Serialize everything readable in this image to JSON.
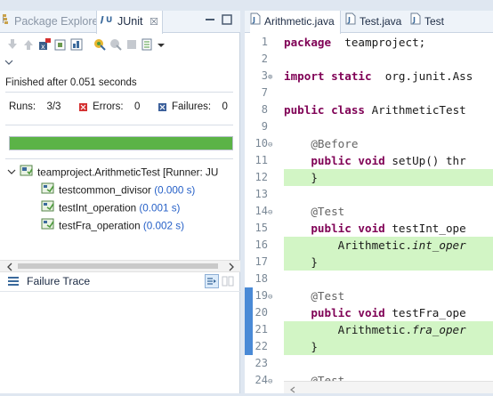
{
  "left_view": {
    "tabs": {
      "package_explorer": "Package Explorer",
      "junit": "JUnit",
      "junit_close": "☒"
    },
    "status": "Finished after 0.051 seconds",
    "counters": {
      "runs_label": "Runs:",
      "runs_value": "3/3",
      "errors_label": "Errors:",
      "errors_value": "0",
      "failures_label": "Failures:",
      "failures_value": "0"
    },
    "progress": 1.0,
    "progress_color": "#5bb347",
    "tree": {
      "root": "teamproject.ArithmeticTest [Runner: JU",
      "tests": [
        {
          "name": "testcommon_divisor",
          "time": "(0.000 s)"
        },
        {
          "name": "testInt_operation",
          "time": "(0.001 s)"
        },
        {
          "name": "testFra_operation",
          "time": "(0.002 s)"
        }
      ]
    },
    "failure_trace": "Failure Trace"
  },
  "editor": {
    "tabs": [
      "Arithmetic.java",
      "Test.java",
      "Test"
    ],
    "lines": [
      {
        "n": "1",
        "fold": "",
        "hl": false,
        "parts": [
          [
            "kw",
            "package"
          ],
          [
            "",
            "  teamproject;"
          ]
        ]
      },
      {
        "n": "2",
        "fold": "",
        "hl": false,
        "parts": []
      },
      {
        "n": "3",
        "fold": "⊕",
        "hl": false,
        "parts": [
          [
            "kw",
            "import static"
          ],
          [
            "",
            "  org.junit.Ass"
          ]
        ]
      },
      {
        "n": "7",
        "fold": "",
        "hl": false,
        "parts": []
      },
      {
        "n": "8",
        "fold": "",
        "hl": false,
        "parts": [
          [
            "kw",
            "public class"
          ],
          [
            "",
            " ArithmeticTest"
          ]
        ]
      },
      {
        "n": "9",
        "fold": "",
        "hl": false,
        "parts": []
      },
      {
        "n": "10",
        "fold": "⊖",
        "hl": false,
        "parts": [
          [
            "an",
            "    @Before"
          ]
        ]
      },
      {
        "n": "11",
        "fold": "",
        "hl": false,
        "parts": [
          [
            "kw",
            "    public void"
          ],
          [
            "",
            " setUp() thr"
          ]
        ]
      },
      {
        "n": "12",
        "fold": "",
        "hl": true,
        "parts": [
          [
            "",
            "    }"
          ]
        ]
      },
      {
        "n": "13",
        "fold": "",
        "hl": false,
        "parts": []
      },
      {
        "n": "14",
        "fold": "⊖",
        "hl": false,
        "parts": [
          [
            "an",
            "    @Test"
          ]
        ]
      },
      {
        "n": "15",
        "fold": "",
        "hl": false,
        "parts": [
          [
            "kw",
            "    public void"
          ],
          [
            "",
            " testInt_ope"
          ]
        ]
      },
      {
        "n": "16",
        "fold": "",
        "hl": true,
        "parts": [
          [
            "",
            "        Arithmetic."
          ],
          [
            "it",
            "int_oper"
          ]
        ]
      },
      {
        "n": "17",
        "fold": "",
        "hl": true,
        "parts": [
          [
            "",
            "    }"
          ]
        ]
      },
      {
        "n": "18",
        "fold": "",
        "hl": false,
        "parts": []
      },
      {
        "n": "19",
        "fold": "⊖",
        "hl": false,
        "parts": [
          [
            "an",
            "    @Test"
          ]
        ]
      },
      {
        "n": "20",
        "fold": "",
        "hl": false,
        "parts": [
          [
            "kw",
            "    public void"
          ],
          [
            "",
            " testFra_ope"
          ]
        ]
      },
      {
        "n": "21",
        "fold": "",
        "hl": true,
        "parts": [
          [
            "",
            "        Arithmetic."
          ],
          [
            "it",
            "fra_oper"
          ]
        ]
      },
      {
        "n": "22",
        "fold": "",
        "hl": true,
        "parts": [
          [
            "",
            "    }"
          ]
        ]
      },
      {
        "n": "23",
        "fold": "",
        "hl": false,
        "parts": []
      },
      {
        "n": "24",
        "fold": "⊖",
        "hl": false,
        "parts": [
          [
            "an",
            "    @Test"
          ]
        ]
      }
    ]
  }
}
